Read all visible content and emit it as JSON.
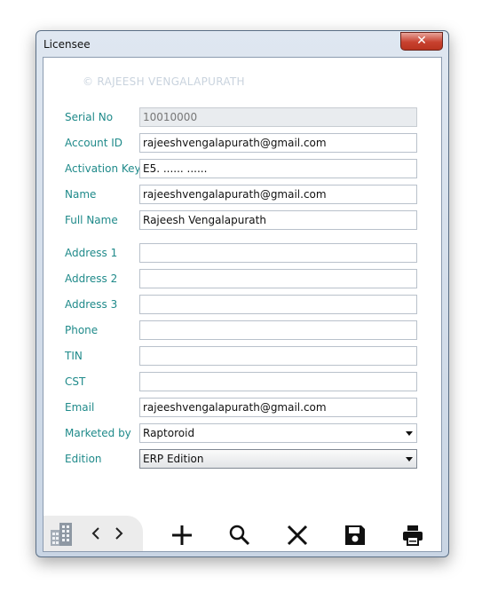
{
  "window": {
    "title": "Licensee",
    "close_glyph": "✕"
  },
  "watermark": "© RAJEESH VENGALAPURATH",
  "fields": {
    "serial_no": {
      "label": "Serial No",
      "value": "10010000"
    },
    "account_id": {
      "label": "Account ID",
      "value": "rajeeshvengalapurath@gmail.com"
    },
    "activation_key": {
      "label": "Activation Key",
      "value": "E5. ...... ......"
    },
    "name": {
      "label": "Name",
      "value": "rajeeshvengalapurath@gmail.com"
    },
    "full_name": {
      "label": "Full Name",
      "value": "Rajeesh Vengalapurath"
    },
    "address1": {
      "label": "Address 1",
      "value": ""
    },
    "address2": {
      "label": "Address 2",
      "value": ""
    },
    "address3": {
      "label": "Address 3",
      "value": ""
    },
    "phone": {
      "label": "Phone",
      "value": ""
    },
    "tin": {
      "label": "TIN",
      "value": ""
    },
    "cst": {
      "label": "CST",
      "value": ""
    },
    "email": {
      "label": "Email",
      "value": "rajeeshvengalapurath@gmail.com"
    },
    "marketed_by": {
      "label": "Marketed by",
      "value": "Raptoroid"
    },
    "edition": {
      "label": "Edition",
      "value": "ERP Edition"
    }
  },
  "toolbar": {
    "icons": [
      "building-icon",
      "chevron-left-icon",
      "chevron-right-icon",
      "add-icon",
      "search-icon",
      "delete-icon",
      "save-icon",
      "print-icon"
    ]
  }
}
